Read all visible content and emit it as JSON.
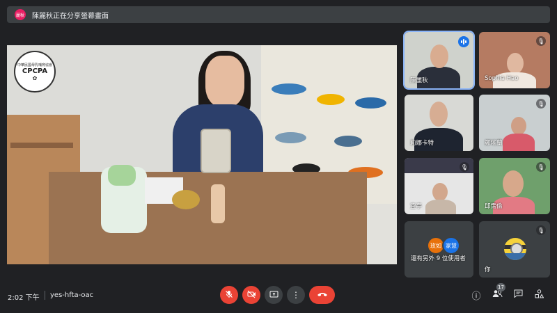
{
  "banner": {
    "avatar_text": "麗秋",
    "text": "陳麗秋正在分享螢幕畫面"
  },
  "presentation": {
    "logo_text": "CPCPA",
    "logo_arc_text": "中華民國母乳哺育協會"
  },
  "participants": [
    {
      "name": "陳麗秋",
      "state": "speaking"
    },
    {
      "name": "Sophia Hao",
      "state": "muted"
    },
    {
      "name": "莉娜卡特",
      "state": "none"
    },
    {
      "name": "鄭瑤蘭",
      "state": "muted"
    },
    {
      "name": "宜亭",
      "state": "muted"
    },
    {
      "name": "邱霈倫",
      "state": "muted"
    }
  ],
  "others": {
    "avatar1": "玫如",
    "avatar2": "家慧",
    "text": "還有另外 9 位使用者"
  },
  "self": {
    "name": "你"
  },
  "meeting": {
    "time": "2:02 下午",
    "code": "yes-hfta-oac"
  },
  "people_count": "17",
  "colors": {
    "background": "#202124",
    "tile": "#3c4043",
    "danger": "#ea4335",
    "accent": "#1a73e8"
  },
  "icons": {
    "mic": "mic-off-icon",
    "camera": "videocam-off-icon",
    "present": "present-icon",
    "more": "more-vert-icon",
    "hangup": "call-end-icon",
    "info": "info-icon",
    "people": "people-icon",
    "chat": "chat-icon",
    "activities": "activities-icon"
  }
}
